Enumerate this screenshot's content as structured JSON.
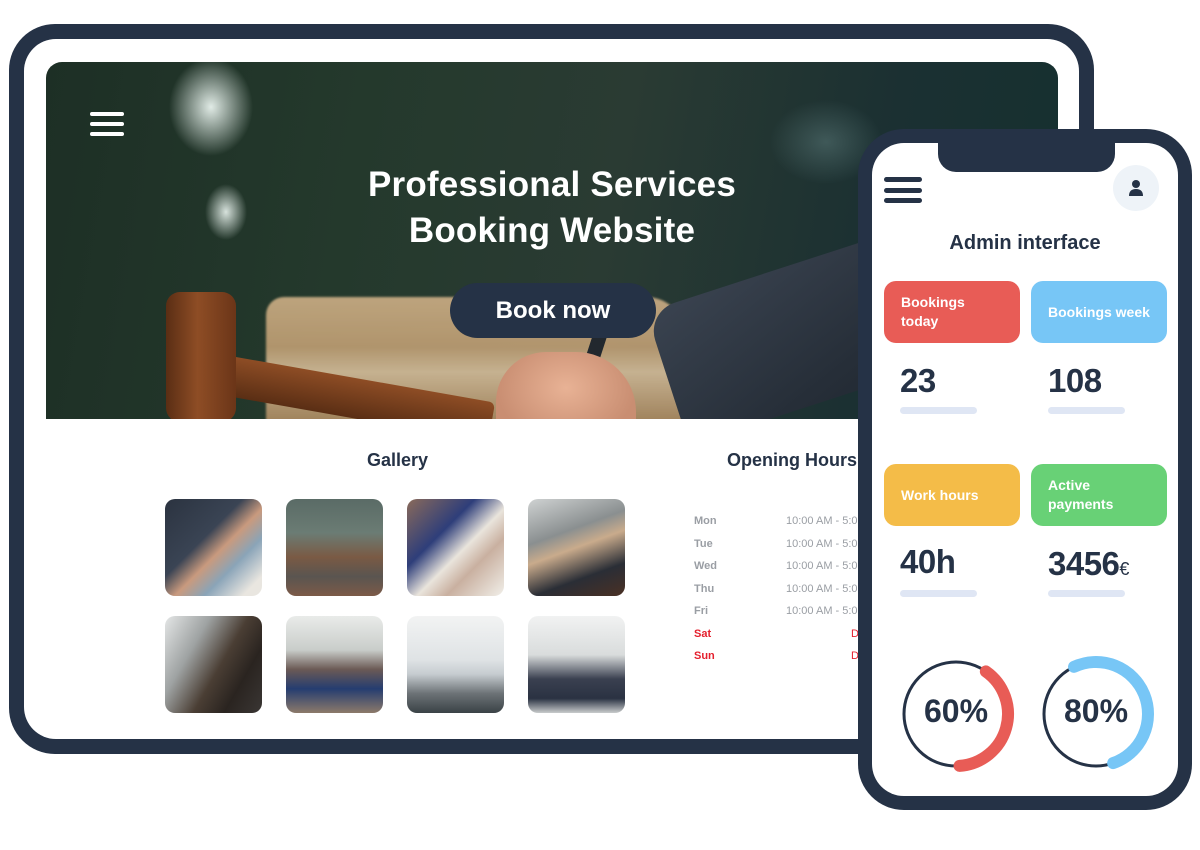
{
  "colors": {
    "navy": "#253246",
    "red": "#e85c56",
    "blue": "#77c6f6",
    "yellow": "#f4bc48",
    "green": "#68d176",
    "closed": "#e5202e",
    "muted": "#9a9ea4",
    "bar": "#dfe6f4"
  },
  "website": {
    "menu_icon": "hamburger-icon",
    "hero": {
      "title_line1": "Professional Services",
      "title_line2": "Booking Website",
      "cta_label": "Book now"
    },
    "gallery": {
      "title": "Gallery",
      "images": [
        {
          "subject": "business handshake"
        },
        {
          "subject": "parliament chamber"
        },
        {
          "subject": "reviewing documents"
        },
        {
          "subject": "conference table"
        },
        {
          "subject": "lounge chairs"
        },
        {
          "subject": "group meeting"
        },
        {
          "subject": "open office"
        },
        {
          "subject": "team presentation"
        }
      ]
    },
    "opening_hours": {
      "title": "Opening Hours",
      "rows": [
        {
          "day": "Mon",
          "hours": "10:00 AM - 5:0",
          "closed": false
        },
        {
          "day": "Tue",
          "hours": "10:00 AM - 5:0",
          "closed": false
        },
        {
          "day": "Wed",
          "hours": "10:00 AM - 5:0",
          "closed": false
        },
        {
          "day": "Thu",
          "hours": "10:00 AM - 5:0",
          "closed": false
        },
        {
          "day": "Fri",
          "hours": "10:00 AM - 5:0",
          "closed": false
        },
        {
          "day": "Sat",
          "hours": "D",
          "closed": true
        },
        {
          "day": "Sun",
          "hours": "D",
          "closed": true
        }
      ]
    }
  },
  "admin": {
    "menu_icon": "hamburger-icon",
    "user_icon": "user-icon",
    "title": "Admin interface",
    "stats": [
      {
        "label": "Bookings today",
        "value": "23",
        "unit": ""
      },
      {
        "label": "Bookings week",
        "value": "108",
        "unit": ""
      },
      {
        "label": "Work hours",
        "value": "40h",
        "unit": ""
      },
      {
        "label": "Active payments",
        "value": "3456",
        "unit": "€"
      }
    ],
    "progress": [
      {
        "label": "60%",
        "value": 0.6
      },
      {
        "label": "80%",
        "value": 0.8
      }
    ]
  }
}
